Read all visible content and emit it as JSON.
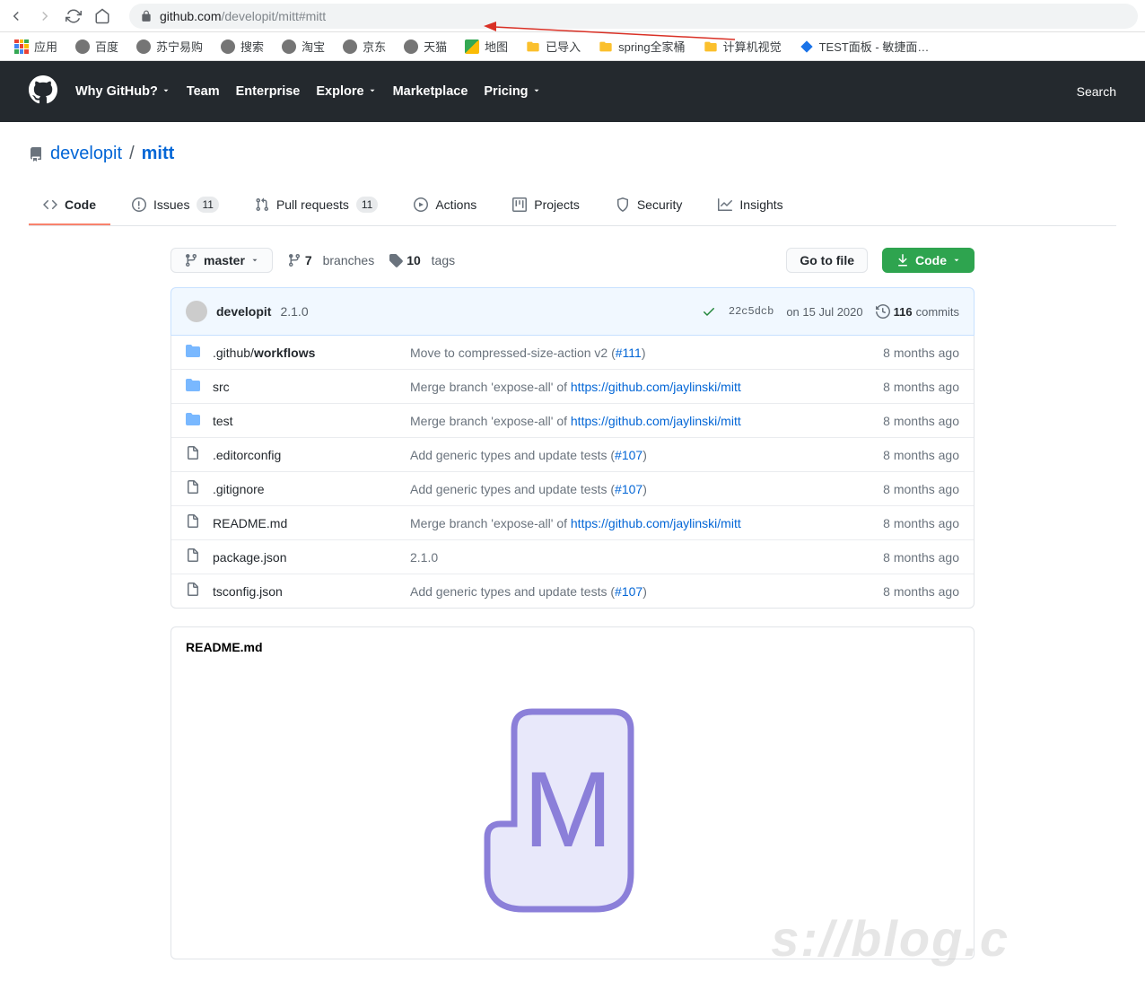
{
  "chrome": {
    "url_host": "github.com",
    "url_path": "/developit/mitt#mitt",
    "bookmarks": [
      {
        "label": "应用",
        "icon": "apps"
      },
      {
        "label": "百度",
        "icon": "globe"
      },
      {
        "label": "苏宁易购",
        "icon": "globe"
      },
      {
        "label": "搜索",
        "icon": "globe"
      },
      {
        "label": "淘宝",
        "icon": "globe"
      },
      {
        "label": "京东",
        "icon": "globe"
      },
      {
        "label": "天猫",
        "icon": "globe"
      },
      {
        "label": "地图",
        "icon": "maps"
      },
      {
        "label": "已导入",
        "icon": "folder"
      },
      {
        "label": "spring全家桶",
        "icon": "folder"
      },
      {
        "label": "计算机视觉",
        "icon": "folder"
      },
      {
        "label": "TEST面板 - 敏捷面…",
        "icon": "diamond"
      }
    ]
  },
  "gh_nav": {
    "items": [
      "Why GitHub?",
      "Team",
      "Enterprise",
      "Explore",
      "Marketplace",
      "Pricing"
    ],
    "search": "Search"
  },
  "repo": {
    "owner": "developit",
    "name": "mitt",
    "tabs": [
      {
        "label": "Code",
        "icon": "code"
      },
      {
        "label": "Issues",
        "icon": "issue",
        "count": "11"
      },
      {
        "label": "Pull requests",
        "icon": "pr",
        "count": "11"
      },
      {
        "label": "Actions",
        "icon": "play"
      },
      {
        "label": "Projects",
        "icon": "project"
      },
      {
        "label": "Security",
        "icon": "shield"
      },
      {
        "label": "Insights",
        "icon": "graph"
      }
    ]
  },
  "filenav": {
    "branch": "master",
    "branches": "7",
    "branches_label": "branches",
    "tags": "10",
    "tags_label": "tags",
    "goto": "Go to file",
    "code": "Code"
  },
  "commit": {
    "author": "developit",
    "msg": "2.1.0",
    "hash": "22c5dcb",
    "date": "on 15 Jul 2020",
    "count": "116",
    "count_label": "commits"
  },
  "files": [
    {
      "type": "dir",
      "name": ".github/",
      "bold": "workflows",
      "msg": "Move to compressed-size-action v2 (",
      "link": "#111",
      "msg2": ")",
      "time": "8 months ago"
    },
    {
      "type": "dir",
      "name": "src",
      "msg": "Merge branch 'expose-all' of ",
      "link": "https://github.com/jaylinski/mitt",
      "time": "8 months ago"
    },
    {
      "type": "dir",
      "name": "test",
      "msg": "Merge branch 'expose-all' of ",
      "link": "https://github.com/jaylinski/mitt",
      "time": "8 months ago"
    },
    {
      "type": "file",
      "name": ".editorconfig",
      "msg": "Add generic types and update tests (",
      "link": "#107",
      "msg2": ")",
      "time": "8 months ago"
    },
    {
      "type": "file",
      "name": ".gitignore",
      "msg": "Add generic types and update tests (",
      "link": "#107",
      "msg2": ")",
      "time": "8 months ago"
    },
    {
      "type": "file",
      "name": "README.md",
      "msg": "Merge branch 'expose-all' of ",
      "link": "https://github.com/jaylinski/mitt",
      "time": "8 months ago"
    },
    {
      "type": "file",
      "name": "package.json",
      "msg": "2.1.0",
      "time": "8 months ago"
    },
    {
      "type": "file",
      "name": "tsconfig.json",
      "msg": "Add generic types and update tests (",
      "link": "#107",
      "msg2": ")",
      "time": "8 months ago"
    }
  ],
  "readme": {
    "title": "README.md"
  }
}
